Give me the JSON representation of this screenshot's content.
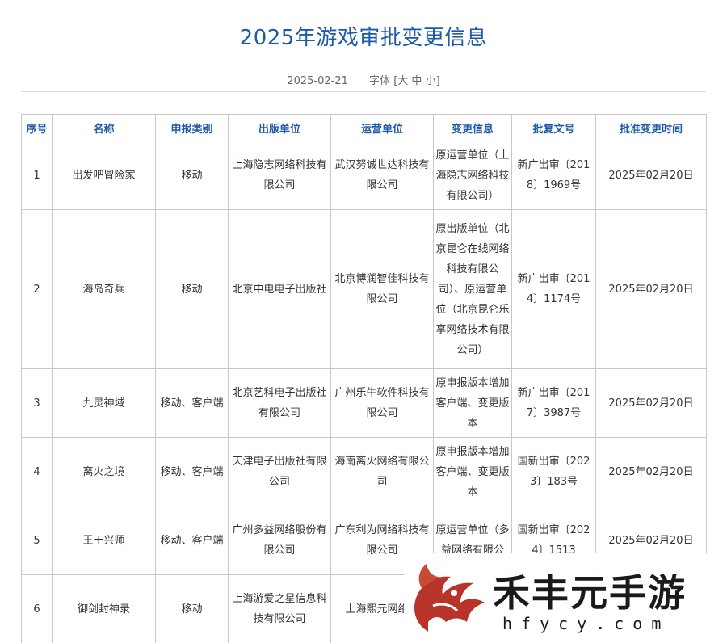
{
  "title": "2025年游戏审批变更信息",
  "meta": {
    "date": "2025-02-21",
    "font_label": "字体",
    "font_open": "[",
    "font_large": "大",
    "font_medium": "中",
    "font_small": "小",
    "font_close": "]"
  },
  "table": {
    "headers": [
      "序号",
      "名称",
      "申报类别",
      "出版单位",
      "运营单位",
      "变更信息",
      "批复文号",
      "批准变更时间"
    ],
    "rows": [
      [
        "1",
        "出发吧冒险家",
        "移动",
        "上海隐志网络科技有限公司",
        "武汉努诚世达科技有限公司",
        "原运营单位（上海隐志网络科技有限公司）",
        "新广出审〔2018〕1969号",
        "2025年02月20日"
      ],
      [
        "2",
        "海岛奇兵",
        "移动",
        "北京中电电子出版社",
        "北京博润智佳科技有限公司",
        "原出版单位（北京昆仑在线网络科技有限公司）、原运营单位（北京昆仑乐享网络技术有限公司）",
        "新广出审〔2014〕1174号",
        "2025年02月20日"
      ],
      [
        "3",
        "九灵神域",
        "移动、客户端",
        "北京艺科电子出版社有限公司",
        "广州乐牛软件科技有限公司",
        "原申报版本增加客户端、变更版本",
        "新广出审〔2017〕3987号",
        "2025年02月20日"
      ],
      [
        "4",
        "离火之境",
        "移动、客户端",
        "天津电子出版社有限公司",
        "海南离火网络有限公司",
        "原申报版本增加客户端、变更版本",
        "国新出审〔2023〕183号",
        "2025年02月20日"
      ],
      [
        "5",
        "王于兴师",
        "移动、客户端",
        "广州多益网络股份有限公司",
        "广东利为网络科技有限公司",
        "原运营单位（多益网络有限公",
        "国新出审〔2024〕1513",
        "2025年02月20日"
      ],
      [
        "6",
        "御剑封神录",
        "移动",
        "上海游爱之星信息科技有限公司",
        "上海熙元网络科",
        "",
        "",
        ""
      ]
    ]
  },
  "watermark": {
    "brand": "禾丰元手游",
    "domain": "hfycy.com",
    "logo_icon": "dragon-logo-icon",
    "logo_color": "#b8342a"
  },
  "colors": {
    "accent": "#1e5aa8",
    "border": "#c8c8c8",
    "text": "#333333"
  }
}
